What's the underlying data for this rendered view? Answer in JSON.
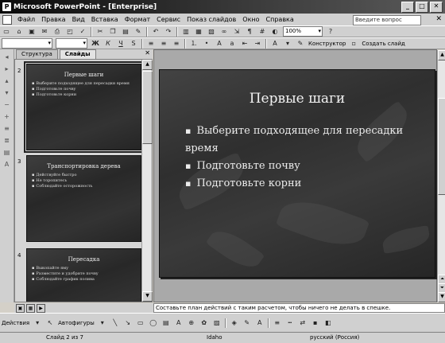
{
  "window": {
    "title": "Microsoft PowerPoint - [Enterprise]"
  },
  "menu": {
    "items": [
      "Файл",
      "Правка",
      "Вид",
      "Вставка",
      "Формат",
      "Сервис",
      "Показ слайдов",
      "Окно",
      "Справка"
    ],
    "help_placeholder": "Введите вопрос"
  },
  "standard_toolbar": {
    "zoom": "100%"
  },
  "formatting_toolbar": {
    "design_label": "Конструктор",
    "new_slide_label": "Создать слайд"
  },
  "outline_tabs": {
    "structure": "Структура",
    "slides": "Слайды"
  },
  "slides": [
    {
      "number": "2",
      "title": "Первые шаги",
      "bullets": [
        "Выберите подходящее для пересадки время",
        "Подготовьте почву",
        "Подготовьте корни"
      ]
    },
    {
      "number": "3",
      "title": "Транспортировка дерева",
      "bullets": [
        "Действуйте быстро",
        "Не торопитесь",
        "Соблюдайте осторожность"
      ]
    },
    {
      "number": "4",
      "title": "Пересадка",
      "bullets": [
        "Выкопайте яму",
        "Разместите и удобрите почву",
        "Соблюдайте график полива"
      ]
    }
  ],
  "current_slide": {
    "title": "Первые шаги",
    "bullets": [
      "Выберите подходящее для пересадки время",
      "Подготовьте почву",
      "Подготовьте корни"
    ]
  },
  "notes": "Составьте план действий с таким расчетом, чтобы ничего не делать в спешке.",
  "drawing_toolbar": {
    "actions_label": "Действия",
    "autoshapes_label": "Автофигуры"
  },
  "status": {
    "slide": "Слайд 2 из 7",
    "design": "Idaho",
    "language": "русский (Россия)"
  }
}
